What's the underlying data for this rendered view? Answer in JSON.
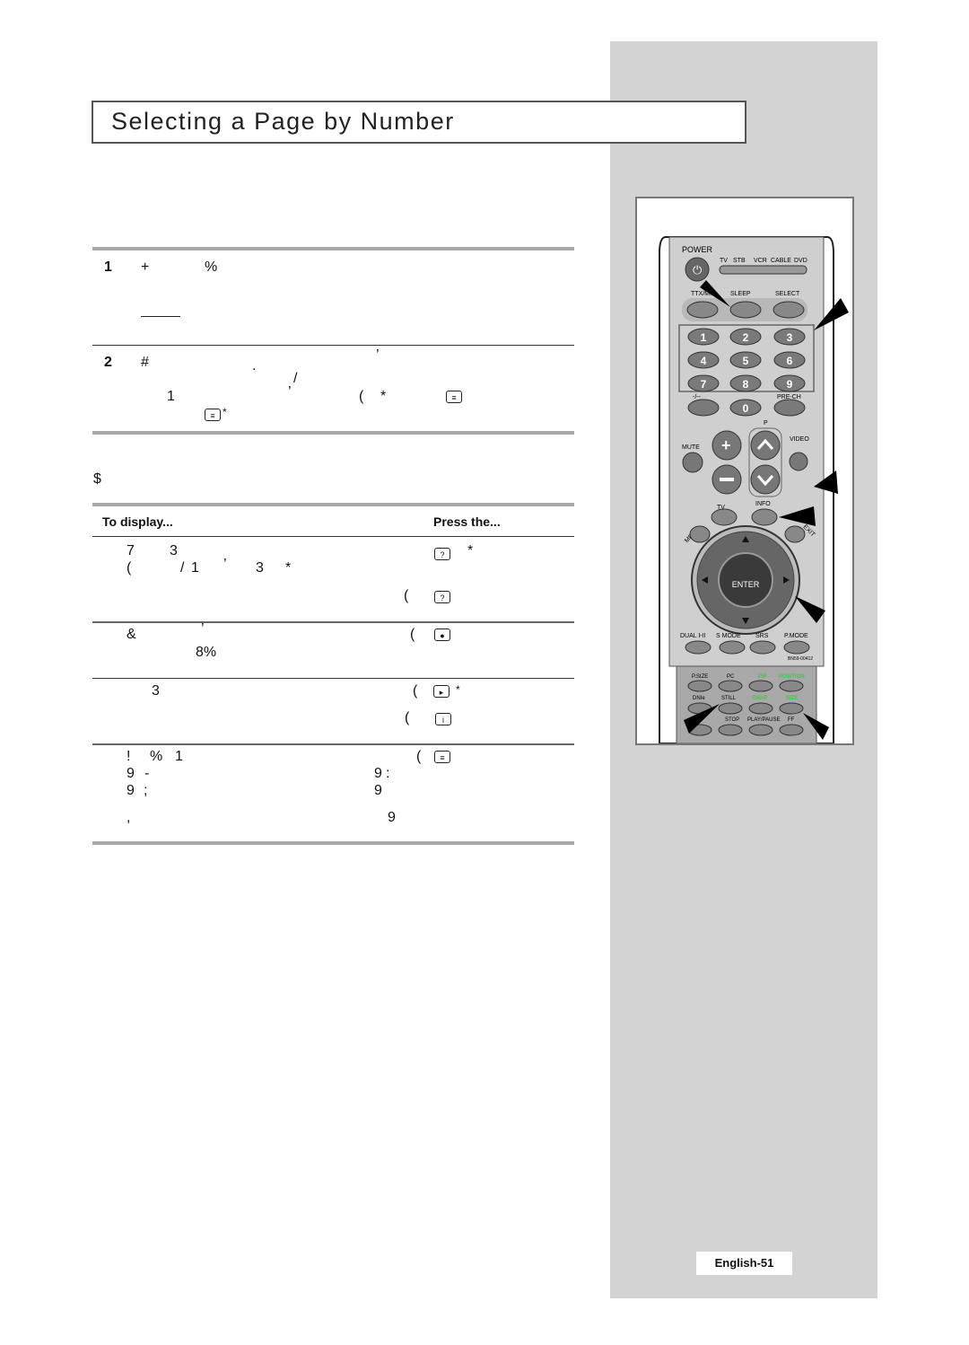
{
  "title": "Selecting a Page by Number",
  "steps": [
    {
      "number": "1",
      "glyphs": [
        "+",
        "%"
      ]
    },
    {
      "number": "2",
      "glyphs": [
        "#",
        ".",
        "’",
        "/",
        "1",
        "’",
        "(",
        "*",
        "*"
      ]
    }
  ],
  "note_glyph": "$",
  "table": {
    "headers": [
      "To display...",
      "Press the..."
    ],
    "rows": [
      {
        "glyphs": [
          "7",
          "3",
          "(",
          "/",
          "1",
          "’",
          "3",
          "*",
          "*",
          "("
        ],
        "icons": [
          "reveal-icon",
          "reveal-icon"
        ]
      },
      {
        "glyphs": [
          "&",
          "’",
          "8%",
          "("
        ],
        "icons": [
          "mix-icon"
        ]
      },
      {
        "glyphs": [
          "3",
          "(",
          "*",
          "("
        ],
        "icons": [
          "hold-icon",
          "index-icon"
        ]
      },
      {
        "glyphs": [
          "!",
          "%",
          "1",
          "9",
          "-",
          "9",
          ";",
          ",",
          "(",
          "9",
          ":",
          "9",
          "9"
        ],
        "icons": [
          "size-icon"
        ]
      }
    ]
  },
  "remote": {
    "power": "POWER",
    "sources": [
      "TV",
      "STB",
      "VCR",
      "CABLE",
      "DVD"
    ],
    "top_buttons": [
      "TTX/MIX",
      "SLEEP",
      "SELECT"
    ],
    "numbers": [
      "1",
      "2",
      "3",
      "4",
      "5",
      "6",
      "7",
      "8",
      "9",
      "0"
    ],
    "dash": "-/--",
    "prech": "PRE-CH",
    "p_label": "P",
    "mute": "MUTE",
    "video": "VIDEO",
    "tv": "TV",
    "info": "INFO",
    "menu": "MENU",
    "exit": "EXIT",
    "enter": "ENTER",
    "mode_buttons": [
      "DUAL I-II",
      "S MODE",
      "SRS",
      "P.MODE"
    ],
    "model": "BN59-00412",
    "row1": [
      "P.SIZE",
      "PC",
      "PIP",
      "POSITION"
    ],
    "row2": [
      "DNIe",
      "STILL",
      "SWAP",
      "SIZE"
    ],
    "row3": [
      "",
      "STOP",
      "PLAY/PAUSE",
      "FF"
    ],
    "green": "#22cc22"
  },
  "page_label": "English-51"
}
